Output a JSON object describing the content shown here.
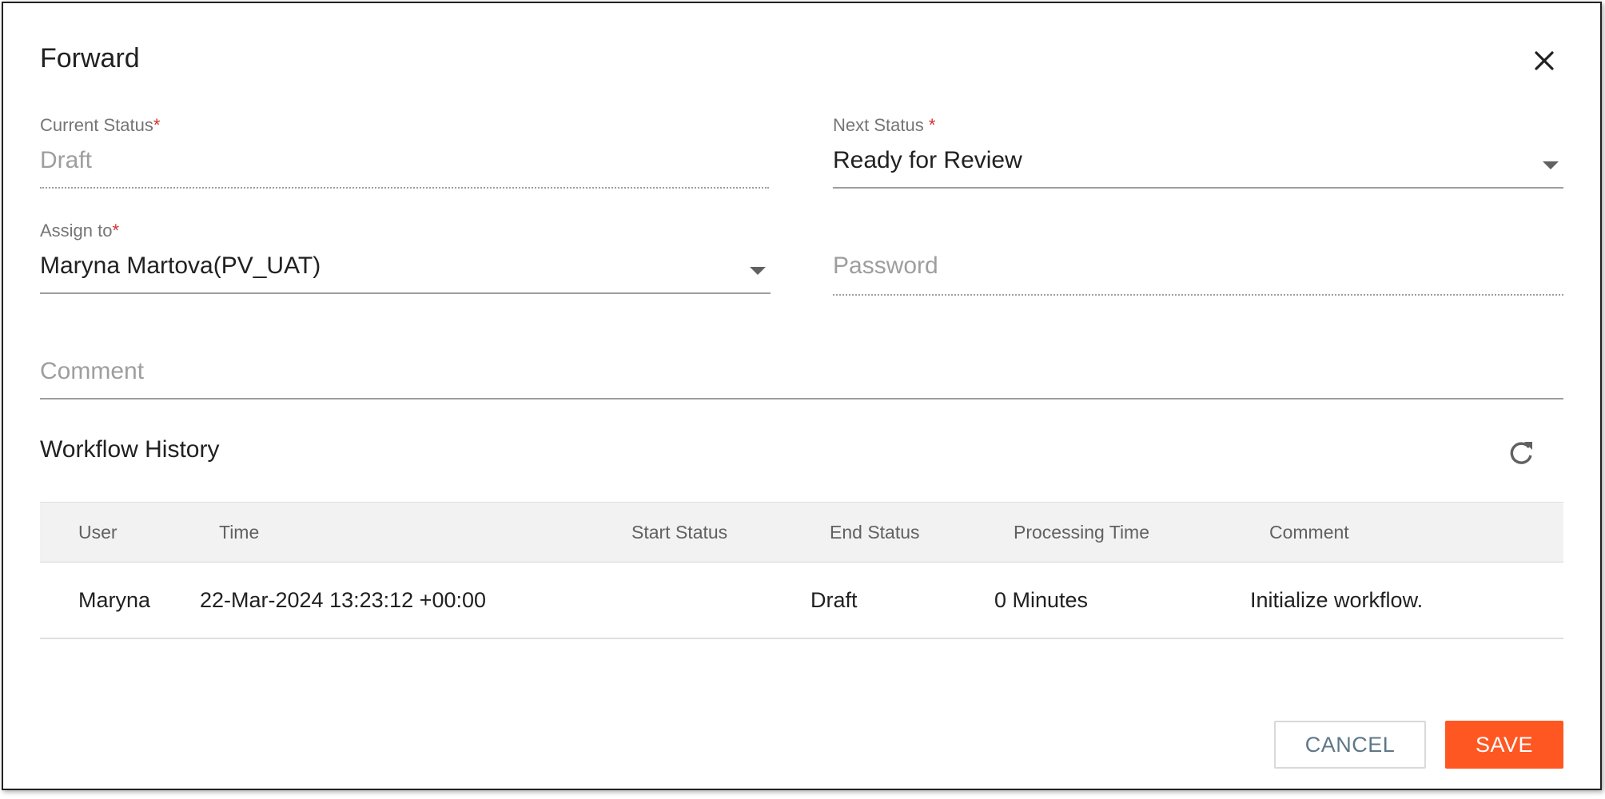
{
  "dialog": {
    "title": "Forward",
    "close_icon": "close-icon"
  },
  "form": {
    "current_status": {
      "label": "Current Status",
      "required_mark": "*",
      "value": "Draft"
    },
    "next_status": {
      "label": "Next Status",
      "required_mark": "*",
      "value": "Ready for Review"
    },
    "assign_to": {
      "label": "Assign to",
      "required_mark": "*",
      "value": "Maryna Martova(PV_UAT)"
    },
    "password": {
      "placeholder": "Password",
      "value": ""
    },
    "comment": {
      "placeholder": "Comment",
      "value": ""
    }
  },
  "workflow_history": {
    "title": "Workflow History",
    "refresh_icon": "refresh-icon",
    "columns": [
      "User",
      "Time",
      "Start Status",
      "End Status",
      "Processing Time",
      "Comment"
    ],
    "rows": [
      {
        "user": "Maryna",
        "time": "22-Mar-2024 13:23:12 +00:00",
        "start_status": "",
        "end_status": "Draft",
        "processing_time": "0 Minutes",
        "comment": "Initialize workflow."
      }
    ]
  },
  "actions": {
    "cancel_label": "CANCEL",
    "save_label": "SAVE"
  },
  "colors": {
    "primary": "#ff5722",
    "required": "#d32f2f",
    "header_bg": "#f2f2f2",
    "cancel_text": "#5f7787"
  }
}
